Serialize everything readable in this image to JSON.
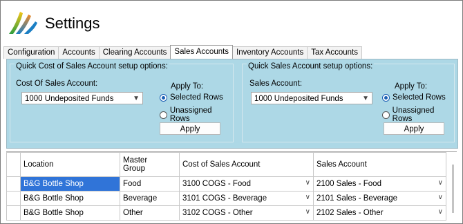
{
  "app": {
    "title": "Settings"
  },
  "tabs": [
    {
      "label": "Configuration"
    },
    {
      "label": "Accounts"
    },
    {
      "label": "Clearing Accounts"
    },
    {
      "label": "Sales Accounts",
      "active": true
    },
    {
      "label": "Inventory Accounts"
    },
    {
      "label": "Tax Accounts"
    }
  ],
  "cost_group": {
    "title": "Quick Cost of Sales Account setup options:",
    "account_label": "Cost Of Sales Account:",
    "account_value": "1000 Undeposited Funds",
    "apply_to_label": "Apply To:",
    "option_selected": "Selected Rows",
    "option_unassigned": "Unassigned Rows",
    "apply_button": "Apply"
  },
  "sales_group": {
    "title": "Quick Sales Account setup options:",
    "account_label": "Sales Account:",
    "account_value": "1000 Undeposited Funds",
    "apply_to_label": "Apply To:",
    "option_selected": "Selected Rows",
    "option_unassigned": "Unassigned Rows",
    "apply_button": "Apply"
  },
  "grid": {
    "columns": {
      "location": "Location",
      "master_group_1": "Master",
      "master_group_2": "Group",
      "cost": "Cost of Sales Account",
      "sales": "Sales Account"
    },
    "rows": [
      {
        "location": "B&G Bottle Shop",
        "group": "Food",
        "cost": "3100 COGS - Food",
        "sales": "2100 Sales - Food"
      },
      {
        "location": "B&G Bottle Shop",
        "group": "Beverage",
        "cost": "3101 COGS - Beverage",
        "sales": "2101 Sales - Beverage"
      },
      {
        "location": "B&G Bottle Shop",
        "group": "Other",
        "cost": "3102 COGS - Other",
        "sales": "2102 Sales - Other"
      }
    ]
  },
  "colors": {
    "panel_bg": "#add8e6",
    "selection": "#3074d8",
    "radio_accent": "#1a5fb4"
  }
}
